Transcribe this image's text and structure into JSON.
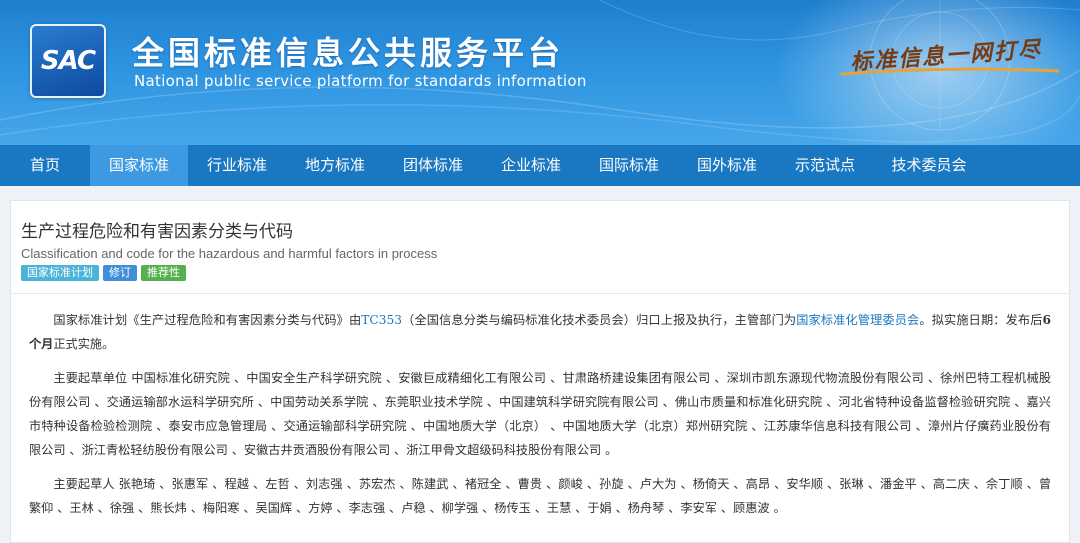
{
  "colors": {
    "nav_bg": "#1a78c2",
    "nav_active": "#3d9ae2",
    "link": "#1a78c2",
    "badge_plan": "#4ab3d8",
    "badge_revise": "#3f8fd8",
    "badge_recommend": "#55b04f"
  },
  "header": {
    "logo_text": "SAC",
    "title": "全国标准信息公共服务平台",
    "subtitle": "National public service platform  for standards information",
    "slogan": "标准信息一网打尽"
  },
  "nav": {
    "items": [
      {
        "label": "首页",
        "active": false
      },
      {
        "label": "国家标准",
        "active": true
      },
      {
        "label": "行业标准",
        "active": false
      },
      {
        "label": "地方标准",
        "active": false
      },
      {
        "label": "团体标准",
        "active": false
      },
      {
        "label": "企业标准",
        "active": false
      },
      {
        "label": "国际标准",
        "active": false
      },
      {
        "label": "国外标准",
        "active": false
      },
      {
        "label": "示范试点",
        "active": false
      },
      {
        "label": "技术委员会",
        "active": false
      }
    ]
  },
  "standard": {
    "title_cn": "生产过程危险和有害因素分类与代码",
    "title_en": "Classification and code for the hazardous and harmful factors in process",
    "badges": [
      "国家标准计划",
      "修订",
      "推荐性"
    ]
  },
  "desc": {
    "p1_a": "国家标准计划《生产过程危险和有害因素分类与代码》由",
    "p1_tc": "TC353",
    "p1_b": "（全国信息分类与编码标准化技术委员会）归口上报及执行，主管部门为",
    "p1_dept": "国家标准化管理委员会",
    "p1_c": "。拟实施日期：发布后",
    "p1_months": "6个月",
    "p1_d": "正式实施。"
  },
  "drafting_units": {
    "label": "主要起草单位",
    "text": "中国标准化研究院 、中国安全生产科学研究院 、安徽巨成精细化工有限公司 、甘肃路桥建设集团有限公司 、深圳市凯东源现代物流股份有限公司 、徐州巴特工程机械股份有限公司 、交通运输部水运科学研究所 、中国劳动关系学院 、东莞职业技术学院 、中国建筑科学研究院有限公司 、佛山市质量和标准化研究院 、河北省特种设备监督检验研究院 、嘉兴市特种设备检验检测院 、泰安市应急管理局 、交通运输部科学研究院 、中国地质大学（北京） 、中国地质大学（北京）郑州研究院 、江苏康华信息科技有限公司 、漳州片仔癀药业股份有限公司 、浙江青松轻纺股份有限公司 、安徽古井贡酒股份有限公司 、浙江甲骨文超级码科技股份有限公司 。"
  },
  "drafters": {
    "label": "主要起草人",
    "text": "张艳琦 、张惠军 、程越 、左哲 、刘志强 、苏宏杰 、陈建武 、褚冠全 、曹贵 、颜峻 、孙旋 、卢大为 、杨倚天 、高昂 、安华顺 、张琳 、潘金平 、高二庆 、佘丁顺 、曾繁仰 、王林 、徐强 、熊长炜 、梅阳寒 、吴国辉 、方婷 、李志强 、卢稳 、柳学强 、杨传玉 、王慧 、于娟 、杨舟琴 、李安军 、顾惠波 。"
  }
}
